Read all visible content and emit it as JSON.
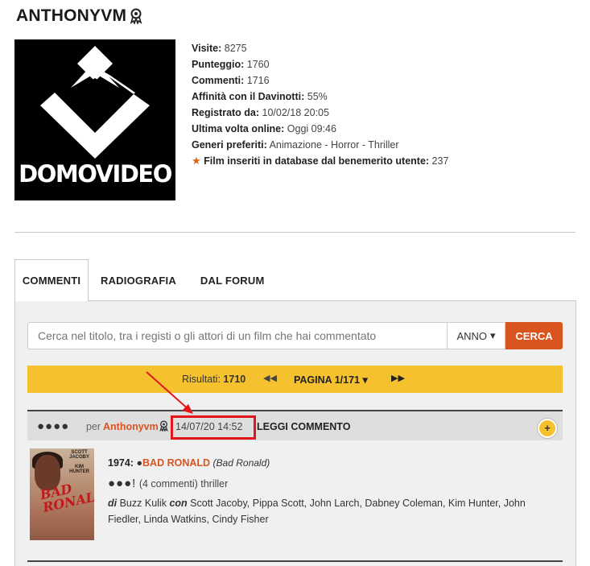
{
  "profile": {
    "username": "ANTHONYVM",
    "logo_text": "DOMOVIDEO",
    "stats": [
      {
        "label": "Visite:",
        "value": "8275"
      },
      {
        "label": "Punteggio:",
        "value": "1760"
      },
      {
        "label": "Commenti:",
        "value": "1716"
      },
      {
        "label": "Affinità con il Davinotti:",
        "value": "55%"
      },
      {
        "label": "Registrato da:",
        "value": "10/02/18 20:05"
      },
      {
        "label": "Ultima volta online:",
        "value": "Oggi 09:46"
      },
      {
        "label": "Generi preferiti:",
        "value": "Animazione - Horror - Thriller"
      },
      {
        "label": "Film inseriti in database dal benemerito utente:",
        "value": "237"
      }
    ]
  },
  "tabs": [
    {
      "label": "COMMENTI",
      "active": true
    },
    {
      "label": "RADIOGRAFIA",
      "active": false
    },
    {
      "label": "DAL FORUM",
      "active": false
    }
  ],
  "search": {
    "placeholder": "Cerca nel titolo, tra i registi o gli attori di un film che hai commentato",
    "year_label": "ANNO",
    "button_label": "CERCA"
  },
  "pager": {
    "results_label": "Risultati:",
    "results_count": "1710",
    "page_label": "PAGINA 1/171"
  },
  "comment": {
    "rating_dots": "●●●●",
    "by_label": "per",
    "user": "Anthonyvm",
    "date": "14/07/20 14:52",
    "read_label": "LEGGI COMMENTO",
    "plus": "+"
  },
  "film": {
    "year": "1974:",
    "title": "BAD RONALD",
    "original_title": "(Bad Ronald)",
    "rating": "●●●!",
    "comments_info": "(4 commenti) thriller",
    "director_prefix": "di",
    "director": "Buzz Kulik",
    "cast_prefix": "con",
    "cast": "Scott Jacoby, Pippa Scott, John Larch, Dabney Coleman, Kim Hunter, John Fiedler, Linda Watkins, Cindy Fisher",
    "poster_credits": "SCOTT\nJACOBY\n\nKIM\nHUNTER",
    "poster_title": "BAD\nRONALD"
  },
  "colors": {
    "accent": "#d9541e",
    "pager_bg": "#f5c12e",
    "highlight": "#e0161b"
  }
}
